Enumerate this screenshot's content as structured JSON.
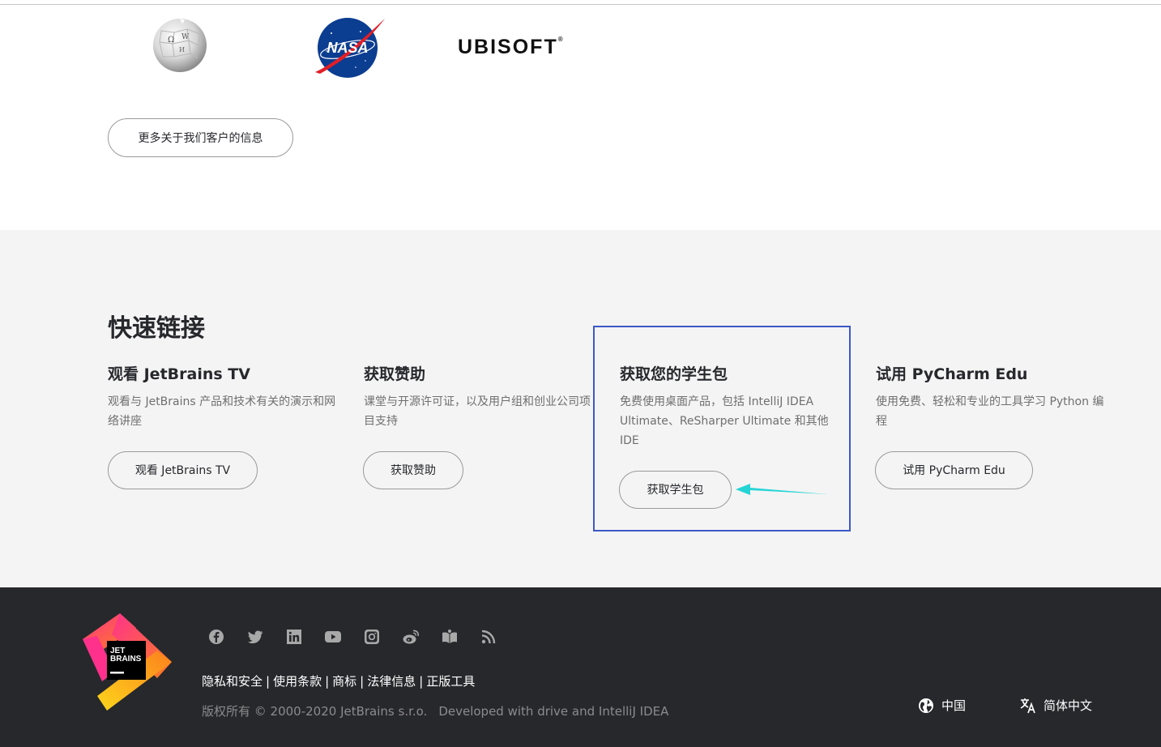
{
  "customers": {
    "logos": [
      {
        "name": "wikipedia-logo"
      },
      {
        "name": "nasa-logo",
        "text": "NASA"
      },
      {
        "name": "ubisoft-logo",
        "text": "UBISOFT"
      }
    ],
    "more_button": "更多关于我们客户的信息"
  },
  "quick_links": {
    "title": "快速链接",
    "cards": [
      {
        "title": "观看 JetBrains TV",
        "desc": "观看与 JetBrains 产品和技术有关的演示和网络讲座",
        "button": "观看 JetBrains TV"
      },
      {
        "title": "获取赞助",
        "desc": "课堂与开源许可证，以及用户组和创业公司项目支持",
        "button": "获取赞助"
      },
      {
        "title": "获取您的学生包",
        "desc": "免费使用桌面产品，包括 IntelliJ IDEA Ultimate、ReSharper Ultimate 和其他 IDE",
        "button": "获取学生包"
      },
      {
        "title": "试用 PyCharm Edu",
        "desc": "使用免费、轻松和专业的工具学习 Python 编程",
        "button": "试用 PyCharm Edu"
      }
    ]
  },
  "footer": {
    "logo_text": [
      "JET",
      "BRAINS"
    ],
    "social_icons": [
      "facebook-icon",
      "twitter-icon",
      "linkedin-icon",
      "youtube-icon",
      "instagram-icon",
      "weibo-icon",
      "reader-icon",
      "rss-icon"
    ],
    "links": [
      "隐私和安全",
      "使用条款",
      "商标",
      "法律信息",
      "正版工具"
    ],
    "copyright": "版权所有 © 2000-2020 JetBrains s.r.o.",
    "developed": "Developed with drive and IntelliJ IDEA",
    "region": "中国",
    "language": "简体中文"
  },
  "colors": {
    "highlight_border": "#3d58c7",
    "arrow": "#26d4d6",
    "footer_bg": "#27282c",
    "quick_bg": "#f4f4f4"
  }
}
